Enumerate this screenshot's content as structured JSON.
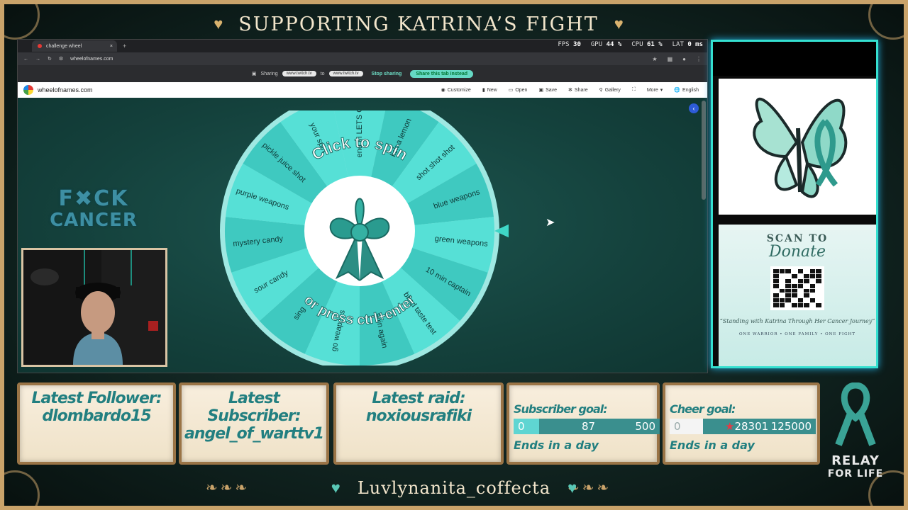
{
  "overlay": {
    "title": "SUPPORTING KATRINA’S FIGHT",
    "heart_glyph": "♥",
    "streamer_name": "Luvlynanita_coffecta",
    "badge": {
      "line1": "F✖CK",
      "line2": "CANCER"
    },
    "relay": {
      "line1": "RELAY",
      "line2": "FOR LIFE"
    }
  },
  "browser": {
    "tab_title": "challenge wheel",
    "tab_close": "×",
    "new_tab": "+",
    "url": "wheelofnames.com",
    "stats": {
      "fps_label": "FPS",
      "fps": "30",
      "gpu_label": "GPU",
      "gpu": "44 %",
      "cpu_label": "CPU",
      "cpu": "61 %",
      "lat_label": "LAT",
      "lat": "0 ms"
    },
    "share": {
      "label": "Sharing",
      "from": "www.twitch.tv",
      "to_word": "to",
      "to": "www.twitch.tv",
      "stop": "Stop sharing",
      "share_tab": "Share this tab instead"
    }
  },
  "wheelofnames": {
    "site": "wheelofnames.com",
    "menu": [
      "Customize",
      "New",
      "Open",
      "Save",
      "Share",
      "Gallery",
      "More",
      "English"
    ],
    "center_top": "Click to spin",
    "center_bottom": "or press ctrl+enter",
    "entries": [
      "end in LETS GO",
      "lick a lemon",
      "shot shot shot",
      "blue weapons",
      "green weapons",
      "10 min captain",
      "blind taste test",
      "spin again",
      "go weapons",
      "sing",
      "sour candy",
      "mystery candy",
      "purple weapons",
      "pickle juice shot",
      "your spin"
    ],
    "colors": {
      "light": "#56e0d6",
      "dark": "#3fc9c0",
      "rim": "#9fe8e2",
      "accent": "#3fd6c6"
    }
  },
  "right_panel": {
    "scan": "SCAN TO",
    "donate": "Donate",
    "quote": "“Standing with Katrina Through Her Cancer Journey”",
    "footer": "ONE WARRIOR  •  ONE FAMILY  •  ONE FIGHT"
  },
  "cards": {
    "follower": {
      "title": "Latest Follower:",
      "value": "dlombardo15"
    },
    "subscriber": {
      "title": "Latest Subscriber:",
      "value": "angel_of_warttv1"
    },
    "raid": {
      "title": "Latest raid:",
      "value": "noxiousrafiki"
    },
    "sub_goal": {
      "title": "Subscriber goal:",
      "start": "0",
      "current": "87",
      "target": "500",
      "progress": 0.174,
      "ends": "Ends in a day"
    },
    "cheer_goal": {
      "title": "Cheer goal:",
      "start": "0",
      "current": "28301",
      "target": "125000",
      "progress": 0.226,
      "ends": "Ends in a day"
    }
  }
}
